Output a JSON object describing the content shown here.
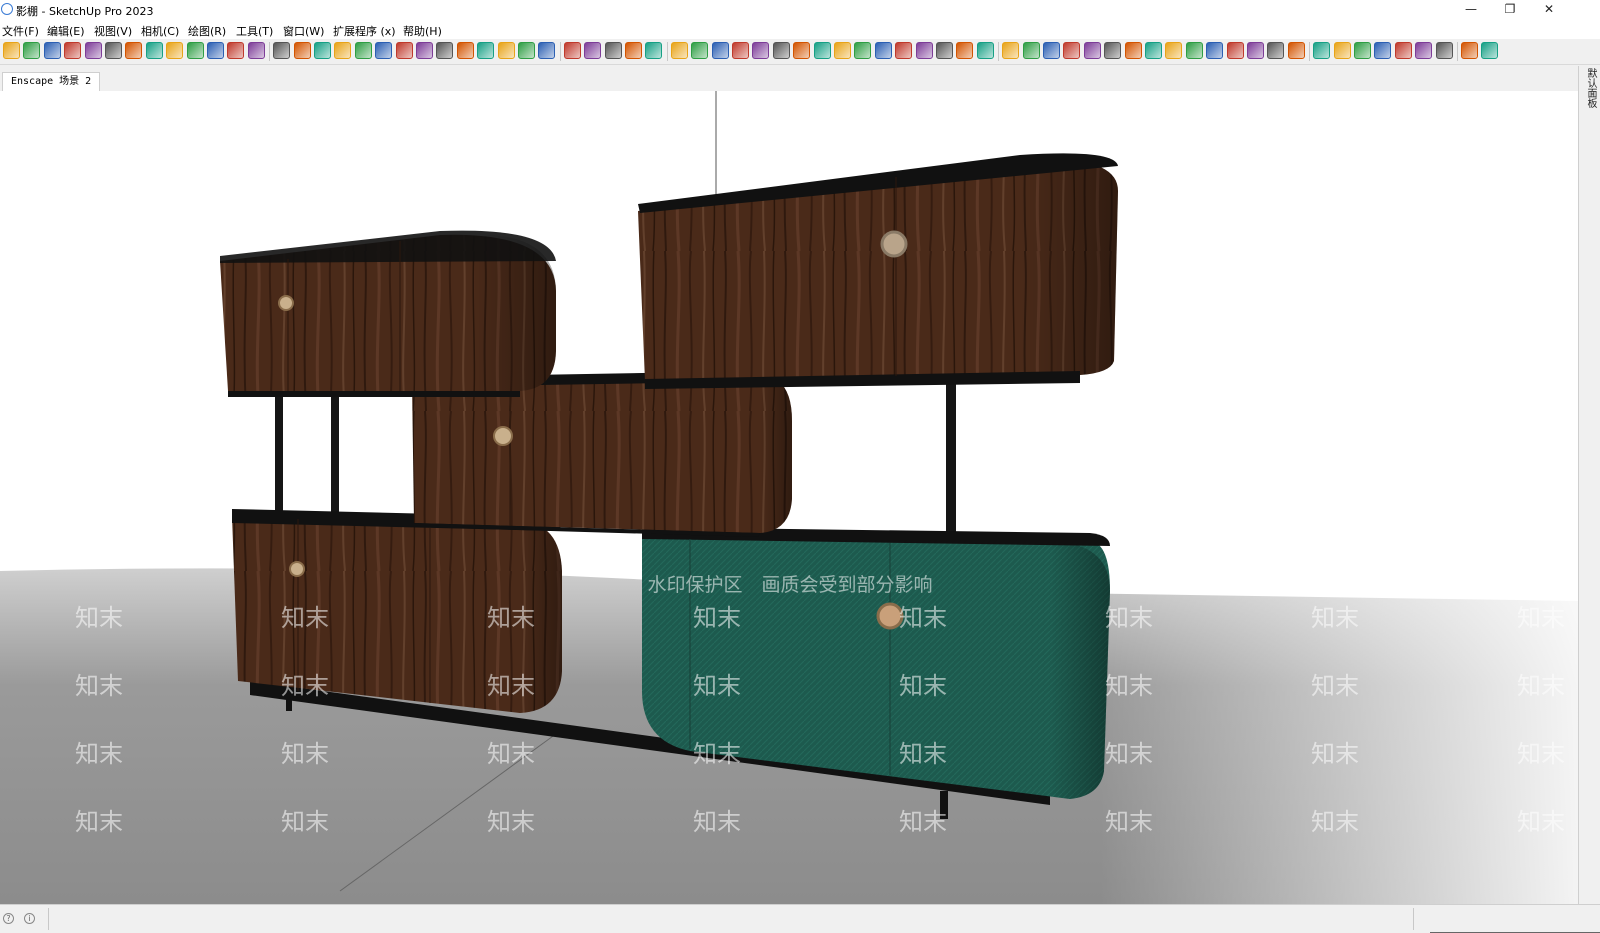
{
  "window": {
    "title": "影棚 - SketchUp Pro 2023",
    "controls": {
      "minimize": "—",
      "restore": "❐",
      "close": "✕"
    }
  },
  "menu": [
    "文件(F)",
    "编辑(E)",
    "视图(V)",
    "相机(C)",
    "绘图(R)",
    "工具(T)",
    "窗口(W)",
    "扩展程序 (x)",
    "帮助(H)"
  ],
  "scene_tab": {
    "label": "Enscape 场景 2"
  },
  "right_panel": {
    "label": "默认面板"
  },
  "watermark": {
    "banner": "水印保护区　画质会受到部分影响",
    "tile_text": "知末"
  },
  "colors": {
    "wood": "#4a2a19",
    "wood_dark": "#2d170d",
    "teal": "#1d5a4e",
    "frame": "#1a1a1a",
    "floor": "#8a8a8a"
  },
  "toolbar_icons": [
    "sketchup-logo-icon",
    "refresh-icon",
    "layers-icon",
    "add-icon",
    "tree-icon",
    "warehouse-icon",
    "cloud-icon",
    "checker-icon",
    "upload-icon",
    "settings-icon",
    "mail-icon",
    "info-icon",
    "user-icon",
    "outliner-icon",
    "array-icon",
    "arrow-up-icon",
    "align-icon",
    "sun-icon",
    "box-icon",
    "cube-icon",
    "cube-orange-icon",
    "pen-icon",
    "cube-gold-icon",
    "cube-tan-icon",
    "cube-open-icon",
    "cube-wire-icon",
    "curve-icon",
    "box-small-icon",
    "globe-icon",
    "pencil-icon",
    "align-left-icon",
    "scale-icon",
    "wall-icon",
    "door-icon",
    "window-icon",
    "cabinet-icon",
    "bin-icon",
    "trash-icon",
    "mesh-icon",
    "draw-icon",
    "tool-icon",
    "color-wheel-icon",
    "stair-icon",
    "frame-icon",
    "layer-icon",
    "lamp-icon",
    "shelf-icon",
    "line-icon",
    "wave-icon",
    "zigzag-icon",
    "flow-icon",
    "grid-icon",
    "hatch-icon",
    "chart-icon",
    "book-icon",
    "cut-icon",
    "network-icon",
    "bell-icon",
    "close-x-icon",
    "table-icon",
    "green-arrow-icon",
    "magenta-arrow-icon",
    "black-arrow-icon",
    "blue-arrow-icon",
    "square-green-icon",
    "key-icon",
    "tag-icon",
    "shield-icon",
    "shield-green-icon",
    "shield-lime-icon",
    "house-icon",
    "gear-green-icon"
  ]
}
